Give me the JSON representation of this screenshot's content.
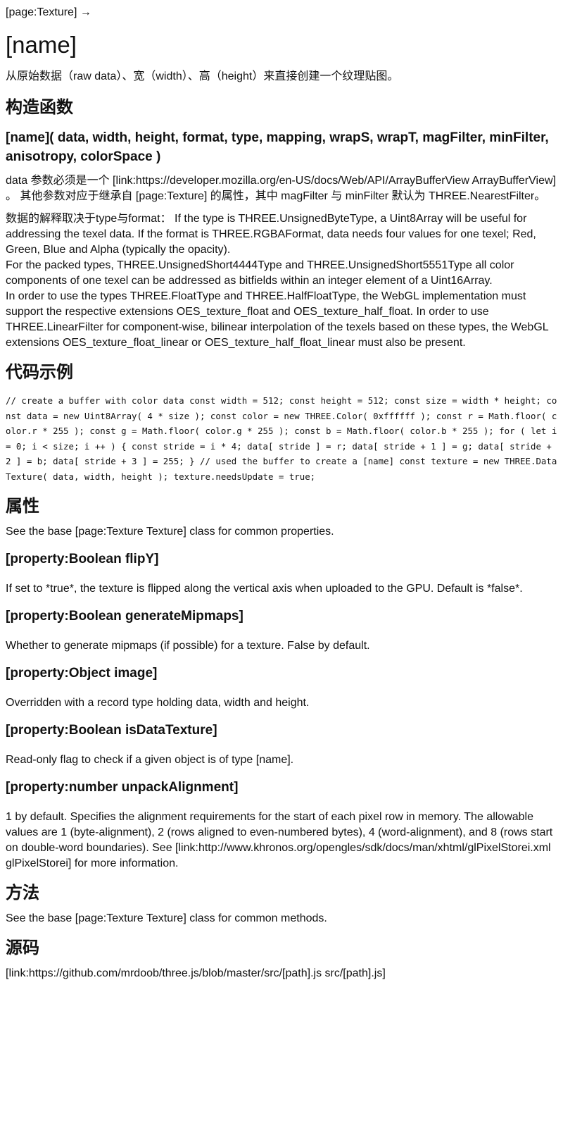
{
  "breadcrumb": "[page:Texture] →",
  "title": "[name]",
  "intro": "从原始数据（raw data）、宽（width）、高（height）来直接创建一个纹理贴图。",
  "constructor": {
    "heading": "构造函数",
    "signature": "[name]( data, width, height, format, type, mapping, wrapS, wrapT, magFilter, minFilter, anisotropy, colorSpace )",
    "data_desc": "data 参数必须是一个 [link:https://developer.mozilla.org/en-US/docs/Web/API/ArrayBufferView ArrayBufferView] 。 其他参数对应于继承自 [page:Texture] 的属性，其中 magFilter 与 minFilter 默认为 THREE.NearestFilter。",
    "format_desc": [
      "数据的解释取决于type与format：   If the type is THREE.UnsignedByteType, a Uint8Array will be useful for addressing the texel data. If the format is THREE.RGBAFormat, data needs four values for one texel; Red, Green, Blue and Alpha (typically the opacity).",
      "For the packed types, THREE.UnsignedShort4444Type and THREE.UnsignedShort5551Type all color components of one texel can be addressed as bitfields within an integer element of a Uint16Array.",
      "In order to use the types THREE.FloatType and THREE.HalfFloatType, the WebGL implementation must support the respective extensions OES_texture_float and OES_texture_half_float. In order to use THREE.LinearFilter for component-wise, bilinear interpolation of the texels based on these types, the WebGL extensions OES_texture_float_linear or OES_texture_half_float_linear must also be present."
    ]
  },
  "example": {
    "heading": "代码示例",
    "code": "// create a buffer with color data const width = 512; const height = 512; const size = width * height; const data = new Uint8Array( 4 * size ); const color = new THREE.Color( 0xffffff ); const r = Math.floor( color.r * 255 ); const g = Math.floor( color.g * 255 ); const b = Math.floor( color.b * 255 ); for ( let i = 0; i < size; i ++ ) { const stride = i * 4; data[ stride ] = r; data[ stride + 1 ] = g; data[ stride + 2 ] = b; data[ stride + 3 ] = 255; } // used the buffer to create a [name] const texture = new THREE.DataTexture( data, width, height ); texture.needsUpdate = true;"
  },
  "properties": {
    "heading": "属性",
    "base_note": "See the base [page:Texture Texture] class for common properties.",
    "items": [
      {
        "name": "[property:Boolean flipY]",
        "desc": "If set to *true*, the texture is flipped along the vertical axis when uploaded to the GPU. Default is *false*."
      },
      {
        "name": "[property:Boolean generateMipmaps]",
        "desc": "Whether to generate mipmaps (if possible) for a texture. False by default."
      },
      {
        "name": "[property:Object image]",
        "desc": "Overridden with a record type holding data, width and height."
      },
      {
        "name": "[property:Boolean isDataTexture]",
        "desc": "Read-only flag to check if a given object is of type [name]."
      },
      {
        "name": "[property:number unpackAlignment]",
        "desc": "1 by default. Specifies the alignment requirements for the start of each pixel row in memory. The allowable values are 1 (byte-alignment), 2 (rows aligned to even-numbered bytes), 4 (word-alignment), and 8 (rows start on double-word boundaries). See [link:http://www.khronos.org/opengles/sdk/docs/man/xhtml/glPixelStorei.xml glPixelStorei] for more information."
      }
    ]
  },
  "methods": {
    "heading": "方法",
    "base_note": "See the base [page:Texture Texture] class for common methods."
  },
  "source": {
    "heading": "源码",
    "link": "[link:https://github.com/mrdoob/three.js/blob/master/src/[path].js src/[path].js]"
  }
}
